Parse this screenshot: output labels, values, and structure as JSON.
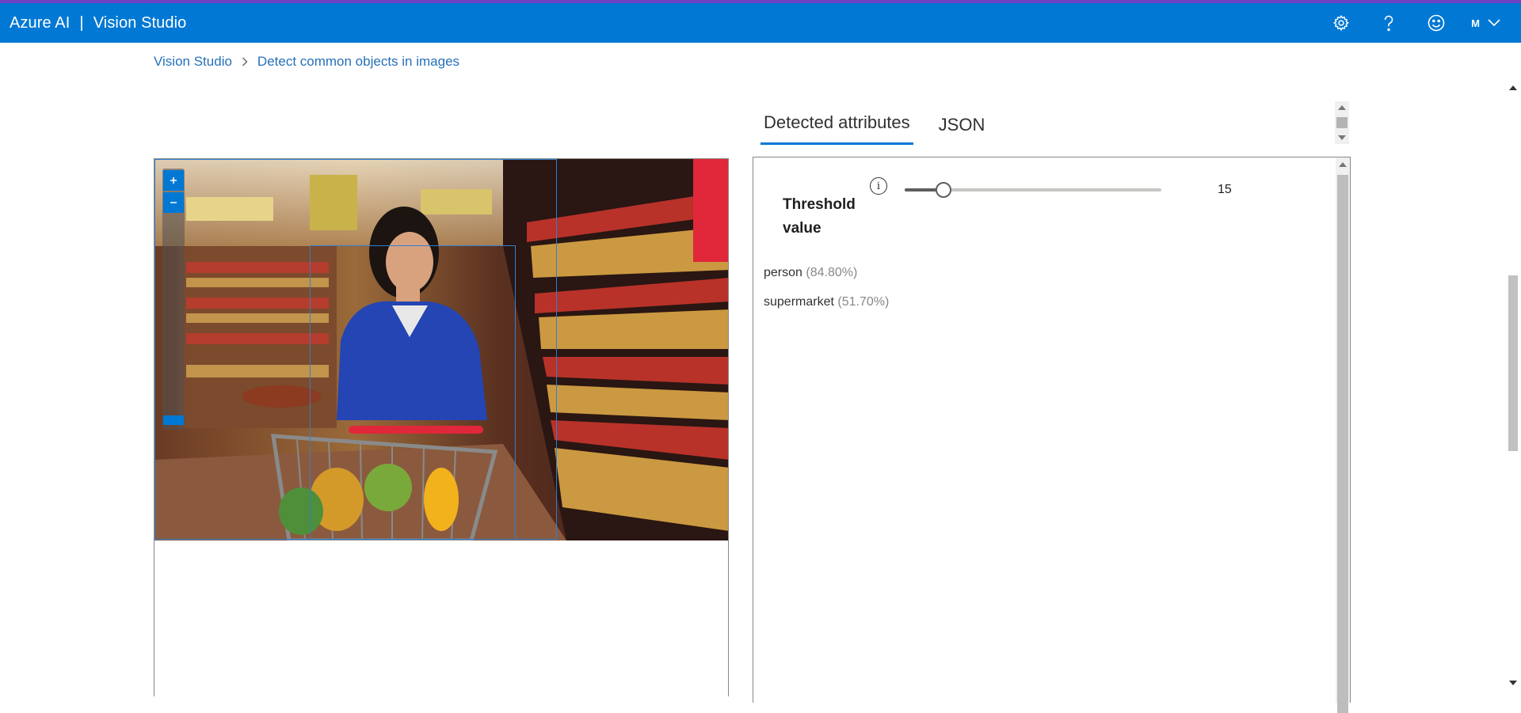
{
  "header": {
    "brand": "Azure AI",
    "separator": "|",
    "product": "Vision Studio",
    "icons": [
      "settings-icon",
      "help-icon",
      "feedback-smiley-icon"
    ],
    "user_initial": "M"
  },
  "breadcrumb": {
    "root": "Vision Studio",
    "current": "Detect common objects in images"
  },
  "tabs": [
    {
      "label": "Detected attributes",
      "active": true
    },
    {
      "label": "JSON",
      "active": false
    }
  ],
  "threshold": {
    "label": "Threshold value",
    "value": "15",
    "fraction": 0.15,
    "info_icon": "info-icon"
  },
  "detections": [
    {
      "name": "person",
      "confidence": "(84.80%)"
    },
    {
      "name": "supermarket",
      "confidence": "(51.70%)"
    }
  ],
  "colors": {
    "header_bg": "#0078d4",
    "accent_strip": "#6f42c1",
    "link": "#2670b8",
    "bbox": "#2f7fd1",
    "confidence_text": "#8a8886"
  }
}
